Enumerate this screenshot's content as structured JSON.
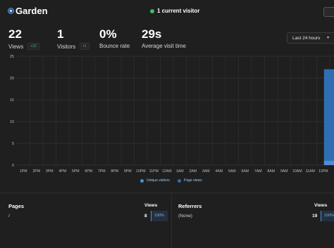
{
  "header": {
    "site_name": "Garden",
    "live_visitors": "1 current visitor"
  },
  "metrics": [
    {
      "value": "22",
      "label": "Views",
      "change": "+22"
    },
    {
      "value": "1",
      "label": "Visitors",
      "change": "+1"
    },
    {
      "value": "0%",
      "label": "Bounce rate",
      "change": ""
    },
    {
      "value": "29s",
      "label": "Average visit time",
      "change": ""
    }
  ],
  "range": {
    "label": "Last 24 hours"
  },
  "colors": {
    "page_views": "#2f6eb5",
    "unique_visitors": "#4f8ed3",
    "live": "#3fb970",
    "background": "#1f1f1f"
  },
  "chart_data": {
    "type": "bar",
    "categories": [
      "1PM",
      "2PM",
      "3PM",
      "4PM",
      "5PM",
      "6PM",
      "7PM",
      "8PM",
      "9PM",
      "10PM",
      "11PM",
      "12AM",
      "1AM",
      "2AM",
      "3AM",
      "4AM",
      "5AM",
      "6AM",
      "7AM",
      "8AM",
      "9AM",
      "10AM",
      "11AM",
      "12PM"
    ],
    "y_ticks": [
      "0",
      "5",
      "10",
      "15",
      "20",
      "25"
    ],
    "ylim": [
      0,
      25
    ],
    "series": [
      {
        "name": "Unique visitors",
        "values": [
          0,
          0,
          0,
          0,
          0,
          0,
          0,
          0,
          0,
          0,
          0,
          0,
          0,
          0,
          0,
          0,
          0,
          0,
          0,
          0,
          0,
          0,
          0,
          1
        ]
      },
      {
        "name": "Page views",
        "values": [
          0,
          0,
          0,
          0,
          0,
          0,
          0,
          0,
          0,
          0,
          0,
          0,
          0,
          0,
          0,
          0,
          0,
          0,
          0,
          0,
          0,
          0,
          0,
          22
        ]
      }
    ],
    "legend_position": "bottom-center",
    "grid": true
  },
  "pages": {
    "title": "Pages",
    "column": "Views",
    "rows": [
      {
        "label": "/",
        "count": "8",
        "percent": "100%"
      }
    ]
  },
  "referrers": {
    "title": "Referrers",
    "column": "Views",
    "rows": [
      {
        "label": "(None)",
        "count": "19",
        "percent": "100%"
      }
    ]
  }
}
